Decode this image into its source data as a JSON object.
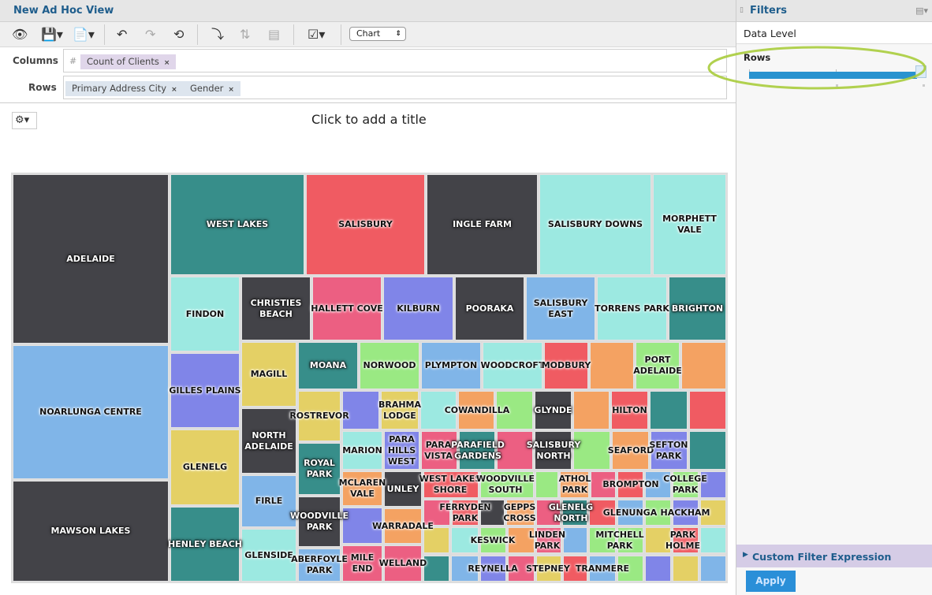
{
  "header": {
    "title": "New Ad Hoc View"
  },
  "toolbar": {
    "view_mode": "Chart",
    "icons": [
      "eye-icon",
      "save-icon",
      "export-icon",
      "undo-icon",
      "redo-icon",
      "undo-all-icon",
      "pivot-icon",
      "sort-icon",
      "table-options-icon",
      "input-controls-icon"
    ]
  },
  "shelves": {
    "columns_label": "Columns",
    "rows_label": "Rows",
    "measure_prefix": "#",
    "columns": [
      "Count of Clients"
    ],
    "rows": [
      "Primary Address City",
      "Gender"
    ],
    "remove_glyph": "×"
  },
  "canvas": {
    "title_placeholder": "Click to add a title"
  },
  "filters": {
    "title": "Filters",
    "data_level": "Data Level",
    "rows_label": "Rows",
    "rows_level_fraction": 1.0,
    "custom_filter": "Custom Filter Expression",
    "apply": "Apply"
  },
  "colors": {
    "dark": "#434348",
    "teal": "#378e8a",
    "red": "#f05b62",
    "cyan": "#9ce9e1",
    "lblue": "#80b5e8",
    "blue": "#8085e8",
    "yellow": "#e4d065",
    "green": "#9ae983",
    "orange": "#f4a262",
    "pink": "#ec5f82",
    "accent": "#2a93cf",
    "highlight": "#a8cc3c"
  },
  "chart_data": {
    "type": "treemap",
    "title": "",
    "measure": "Count of Clients",
    "group_by": [
      "Primary Address City",
      "Gender"
    ],
    "cells": [
      {
        "name": "ADELAIDE",
        "color": "dark"
      },
      {
        "name": "WEST LAKES",
        "color": "teal"
      },
      {
        "name": "SALISBURY",
        "color": "red"
      },
      {
        "name": "INGLE FARM",
        "color": "dark"
      },
      {
        "name": "SALISBURY DOWNS",
        "color": "cyan"
      },
      {
        "name": "MORPHETT\nVALE",
        "color": "cyan"
      },
      {
        "name": "NOARLUNGA CENTRE",
        "color": "lblue"
      },
      {
        "name": "MAWSON LAKES",
        "color": "dark"
      },
      {
        "name": "FINDON",
        "color": "cyan"
      },
      {
        "name": "GILLES PLAINS",
        "color": "blue"
      },
      {
        "name": "GLENELG",
        "color": "yellow"
      },
      {
        "name": "HENLEY BEACH",
        "color": "teal"
      },
      {
        "name": "CHRISTIES\nBEACH",
        "color": "dark"
      },
      {
        "name": "HALLETT COVE",
        "color": "pink"
      },
      {
        "name": "KILBURN",
        "color": "blue"
      },
      {
        "name": "POORAKA",
        "color": "dark"
      },
      {
        "name": "SALISBURY\nEAST",
        "color": "lblue"
      },
      {
        "name": "TORRENS PARK",
        "color": "cyan"
      },
      {
        "name": "BRIGHTON",
        "color": "teal"
      },
      {
        "name": "MAGILL",
        "color": "yellow"
      },
      {
        "name": "NORTH\nADELAIDE",
        "color": "dark"
      },
      {
        "name": "FIRLE",
        "color": "lblue"
      },
      {
        "name": "GLENSIDE",
        "color": "cyan"
      },
      {
        "name": "MOANA",
        "color": "teal"
      },
      {
        "name": "NORWOOD",
        "color": "green"
      },
      {
        "name": "PLYMPTON",
        "color": "lblue"
      },
      {
        "name": "WOODCROFT",
        "color": "cyan"
      },
      {
        "name": "MODBURY",
        "color": "red"
      },
      {
        "name": "",
        "color": "orange"
      },
      {
        "name": "PORT\nADELAIDE",
        "color": "green"
      },
      {
        "name": "",
        "color": "orange"
      },
      {
        "name": "ROSTREVOR",
        "color": "yellow"
      },
      {
        "name": "ROYAL\nPARK",
        "color": "teal"
      },
      {
        "name": "WOODVILLE\nPARK",
        "color": "dark"
      },
      {
        "name": "ABERFOYLE\nPARK",
        "color": "lblue"
      },
      {
        "name": "",
        "color": "blue"
      },
      {
        "name": "BRAHMA\nLODGE",
        "color": "yellow"
      },
      {
        "name": "",
        "color": "orange"
      },
      {
        "name": "",
        "color": "green"
      },
      {
        "name": "COWANDILLA",
        "color": "cyan"
      },
      {
        "name": "GLYNDE",
        "color": "dark"
      },
      {
        "name": "",
        "color": "orange"
      },
      {
        "name": "HILTON",
        "color": "red"
      },
      {
        "name": "",
        "color": "teal"
      },
      {
        "name": "",
        "color": "red"
      },
      {
        "name": "MARION",
        "color": "cyan"
      },
      {
        "name": "PARA\nHILLS\nWEST",
        "color": "blue"
      },
      {
        "name": "PARA\nVISTA",
        "color": "pink"
      },
      {
        "name": "PARAFIELD\nGARDENS",
        "color": "teal"
      },
      {
        "name": "",
        "color": "pink"
      },
      {
        "name": "SALISBURY\nNORTH",
        "color": "dark"
      },
      {
        "name": "",
        "color": "green"
      },
      {
        "name": "SEAFORD",
        "color": "orange"
      },
      {
        "name": "SEFTON\nPARK",
        "color": "blue"
      },
      {
        "name": "",
        "color": "teal"
      },
      {
        "name": "MCLAREN\nVALE",
        "color": "orange"
      },
      {
        "name": "UNLEY",
        "color": "dark"
      },
      {
        "name": "",
        "color": "blue"
      },
      {
        "name": "WARRADALE",
        "color": "orange"
      },
      {
        "name": "MILE\nEND",
        "color": "pink"
      },
      {
        "name": "WELLAND",
        "color": "pink"
      },
      {
        "name": "WEST LAKES\nSHORE",
        "color": "red"
      },
      {
        "name": "WOODVILLE\nSOUTH",
        "color": "green"
      },
      {
        "name": "",
        "color": "green"
      },
      {
        "name": "ATHOL\nPARK",
        "color": "orange"
      },
      {
        "name": "",
        "color": "pink"
      },
      {
        "name": "BROMPTON",
        "color": "red"
      },
      {
        "name": "",
        "color": "lblue"
      },
      {
        "name": "COLLEGE\nPARK",
        "color": "green"
      },
      {
        "name": "",
        "color": "blue"
      },
      {
        "name": "",
        "color": "pink"
      },
      {
        "name": "FERRYDEN\nPARK",
        "color": "red"
      },
      {
        "name": "",
        "color": "dark"
      },
      {
        "name": "GEPPS\nCROSS",
        "color": "orange"
      },
      {
        "name": "",
        "color": "pink"
      },
      {
        "name": "GLENELG\nNORTH",
        "color": "teal"
      },
      {
        "name": "",
        "color": "red"
      },
      {
        "name": "GLENUNGA",
        "color": "lblue"
      },
      {
        "name": "",
        "color": "green"
      },
      {
        "name": "HACKHAM",
        "color": "blue"
      },
      {
        "name": "",
        "color": "yellow"
      },
      {
        "name": "",
        "color": "yellow"
      },
      {
        "name": "",
        "color": "cyan"
      },
      {
        "name": "KESWICK",
        "color": "green"
      },
      {
        "name": "",
        "color": "orange"
      },
      {
        "name": "LINDEN\nPARK",
        "color": "pink"
      },
      {
        "name": "",
        "color": "lblue"
      },
      {
        "name": "",
        "color": "green"
      },
      {
        "name": "MITCHELL\nPARK",
        "color": "green"
      },
      {
        "name": "",
        "color": "yellow"
      },
      {
        "name": "PARK\nHOLME",
        "color": "red"
      },
      {
        "name": "",
        "color": "cyan"
      },
      {
        "name": "",
        "color": "teal"
      },
      {
        "name": "",
        "color": "lblue"
      },
      {
        "name": "REYNELLA",
        "color": "blue"
      },
      {
        "name": "",
        "color": "pink"
      },
      {
        "name": "STEPNEY",
        "color": "yellow"
      },
      {
        "name": "",
        "color": "red"
      },
      {
        "name": "TRANMERE",
        "color": "lblue"
      },
      {
        "name": "",
        "color": "green"
      },
      {
        "name": "",
        "color": "blue"
      },
      {
        "name": "",
        "color": "yellow"
      },
      {
        "name": "",
        "color": "lblue"
      }
    ]
  }
}
